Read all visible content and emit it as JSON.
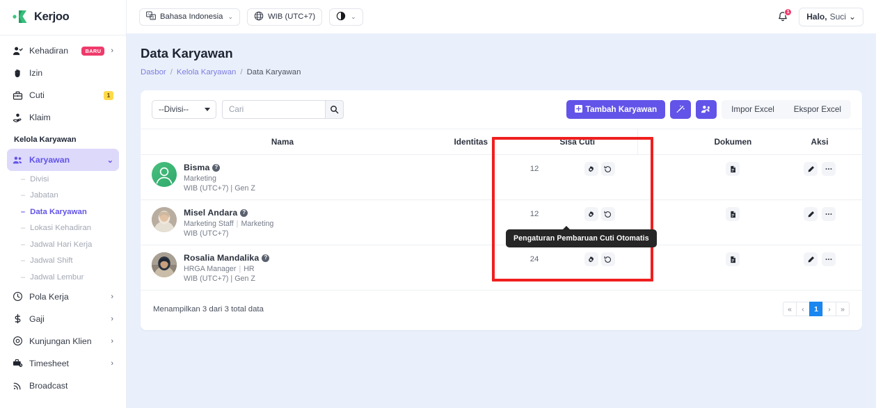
{
  "brand": {
    "name": "Kerjoo",
    "accent": "#6254e8",
    "pink": "#ef3a6b",
    "yellow": "#ffd94a"
  },
  "sidebar": {
    "top_items": [
      {
        "label": "Kehadiran",
        "icon": "user-check-icon",
        "badge": "BARU",
        "chevron": "›"
      },
      {
        "label": "Izin",
        "icon": "hand-icon",
        "badge": "",
        "chevron": ""
      },
      {
        "label": "Cuti",
        "icon": "briefcase-icon",
        "badge": "1",
        "chevron": ""
      },
      {
        "label": "Klaim",
        "icon": "hand-coin-icon",
        "badge": "",
        "chevron": ""
      }
    ],
    "section_title": "Kelola Karyawan",
    "group": {
      "label": "Karyawan",
      "icon": "people-icon",
      "chevron": "⌄"
    },
    "sub_items": [
      {
        "label": "Divisi",
        "active": false
      },
      {
        "label": "Jabatan",
        "active": false
      },
      {
        "label": "Data Karyawan",
        "active": true
      },
      {
        "label": "Lokasi Kehadiran",
        "active": false
      },
      {
        "label": "Jadwal Hari Kerja",
        "active": false
      },
      {
        "label": "Jadwal Shift",
        "active": false
      },
      {
        "label": "Jadwal Lembur",
        "active": false
      }
    ],
    "bottom_items": [
      {
        "label": "Pola Kerja",
        "icon": "clock-icon",
        "chevron": "›"
      },
      {
        "label": "Gaji",
        "icon": "dollar-icon",
        "chevron": "›"
      },
      {
        "label": "Kunjungan Klien",
        "icon": "map-pin-icon",
        "chevron": "›"
      },
      {
        "label": "Timesheet",
        "icon": "timesheet-icon",
        "chevron": "›"
      },
      {
        "label": "Broadcast",
        "icon": "broadcast-icon",
        "chevron": ""
      }
    ]
  },
  "topbar": {
    "language": "Bahasa Indonesia",
    "timezone": "WIB (UTC+7)",
    "theme_caret": "⌄",
    "notification_count": "1",
    "greeting": "Halo,",
    "user_name": "Suci",
    "user_caret": "⌄"
  },
  "page": {
    "title": "Data Karyawan",
    "breadcrumbs": [
      {
        "label": "Dasbor",
        "link": true
      },
      {
        "label": "Kelola Karyawan",
        "link": true
      },
      {
        "label": "Data Karyawan",
        "link": false
      }
    ],
    "breadcrumb_sep": "/"
  },
  "toolbar": {
    "division_selected": "--Divisi--",
    "search_placeholder": "Cari",
    "search_value": "",
    "add_label": "Tambah Karyawan",
    "add_icon": "plus-square-icon",
    "magic_icon": "magic-wand-icon",
    "bulk_icon": "users-gear-icon",
    "import_label": "Impor Excel",
    "export_label": "Ekspor Excel"
  },
  "table": {
    "headers": [
      "Nama",
      "Identitas",
      "Sisa Cuti",
      "",
      "Dokumen",
      "Aksi"
    ],
    "rows": [
      {
        "name": "Bisma",
        "role": "Marketing",
        "role_sub": "",
        "timezone": "WIB (UTC+7)",
        "gen": "Gen Z",
        "identitas": "",
        "sisa_cuti": "12",
        "avatar_type": "gen-green",
        "settings_icon": "gear-icon",
        "history_icon": "history-icon",
        "document_icon": "document-icon",
        "edit_icon": "pencil-icon",
        "more_icon": "ellipsis-icon"
      },
      {
        "name": "Misel Andara",
        "role": "Marketing Staff",
        "role_sub": "Marketing",
        "timezone": "WIB (UTC+7)",
        "gen": "",
        "identitas": "",
        "sisa_cuti": "12",
        "avatar_type": "ph1",
        "settings_icon": "gear-icon",
        "history_icon": "history-icon",
        "document_icon": "document-icon",
        "edit_icon": "pencil-icon",
        "more_icon": "ellipsis-icon"
      },
      {
        "name": "Rosalia Mandalika",
        "role": "HRGA Manager",
        "role_sub": "HR",
        "timezone": "WIB (UTC+7)",
        "gen": "Gen Z",
        "identitas": "",
        "sisa_cuti": "24",
        "avatar_type": "ph2",
        "settings_icon": "gear-icon",
        "history_icon": "history-icon",
        "document_icon": "document-icon",
        "edit_icon": "pencil-icon",
        "more_icon": "ellipsis-icon"
      }
    ],
    "role_separator": "|"
  },
  "tooltip": {
    "text": "Pengaturan Pembaruan Cuti Otomatis"
  },
  "highlight": {
    "color": "#f01f1f"
  },
  "footer": {
    "info": "Menampilkan 3 dari 3 total data",
    "pages": [
      {
        "label": "«",
        "active": false
      },
      {
        "label": "‹",
        "active": false
      },
      {
        "label": "1",
        "active": true
      },
      {
        "label": "›",
        "active": false
      },
      {
        "label": "»",
        "active": false
      }
    ]
  }
}
